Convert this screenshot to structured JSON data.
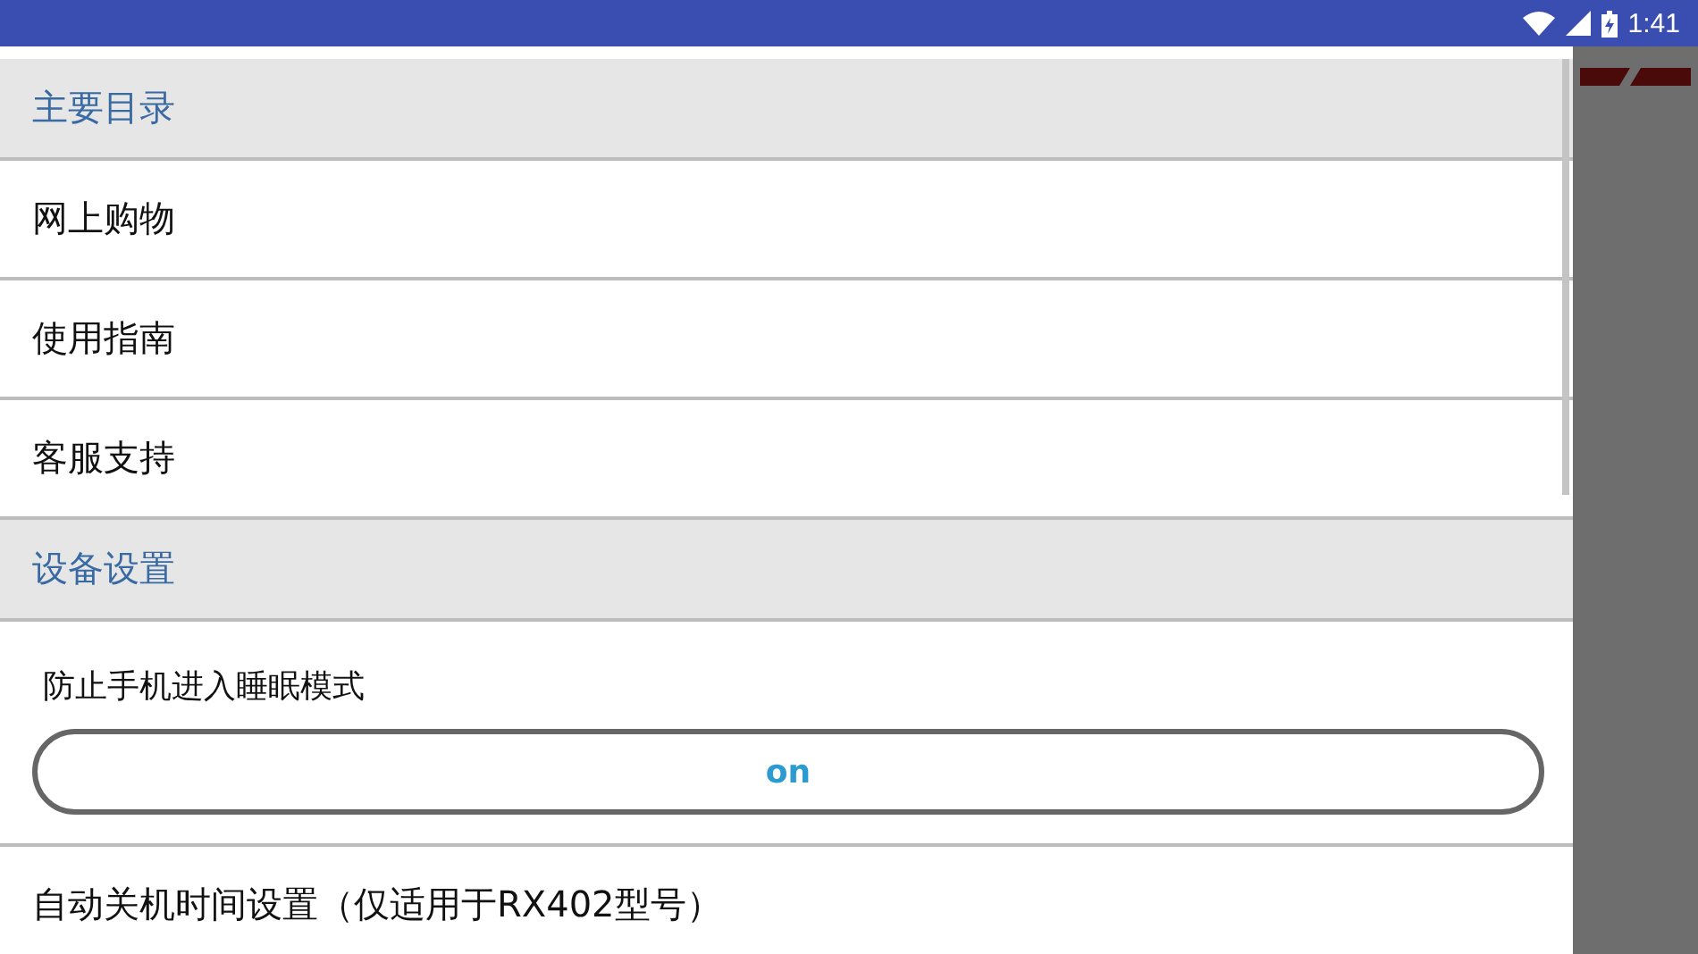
{
  "status_bar": {
    "time": "1:41"
  },
  "sections": [
    {
      "title": "主要目录",
      "items": [
        {
          "kind": "link",
          "label": "网上购物"
        },
        {
          "kind": "link",
          "label": "使用指南"
        },
        {
          "kind": "link",
          "label": "客服支持"
        }
      ]
    },
    {
      "title": "设备设置",
      "items": [
        {
          "kind": "toggle",
          "label": "防止手机进入睡眠模式",
          "on": true,
          "state_text": "on"
        },
        {
          "kind": "link",
          "label": "自动关机时间设置（仅适用于RX402型号）"
        }
      ]
    }
  ]
}
